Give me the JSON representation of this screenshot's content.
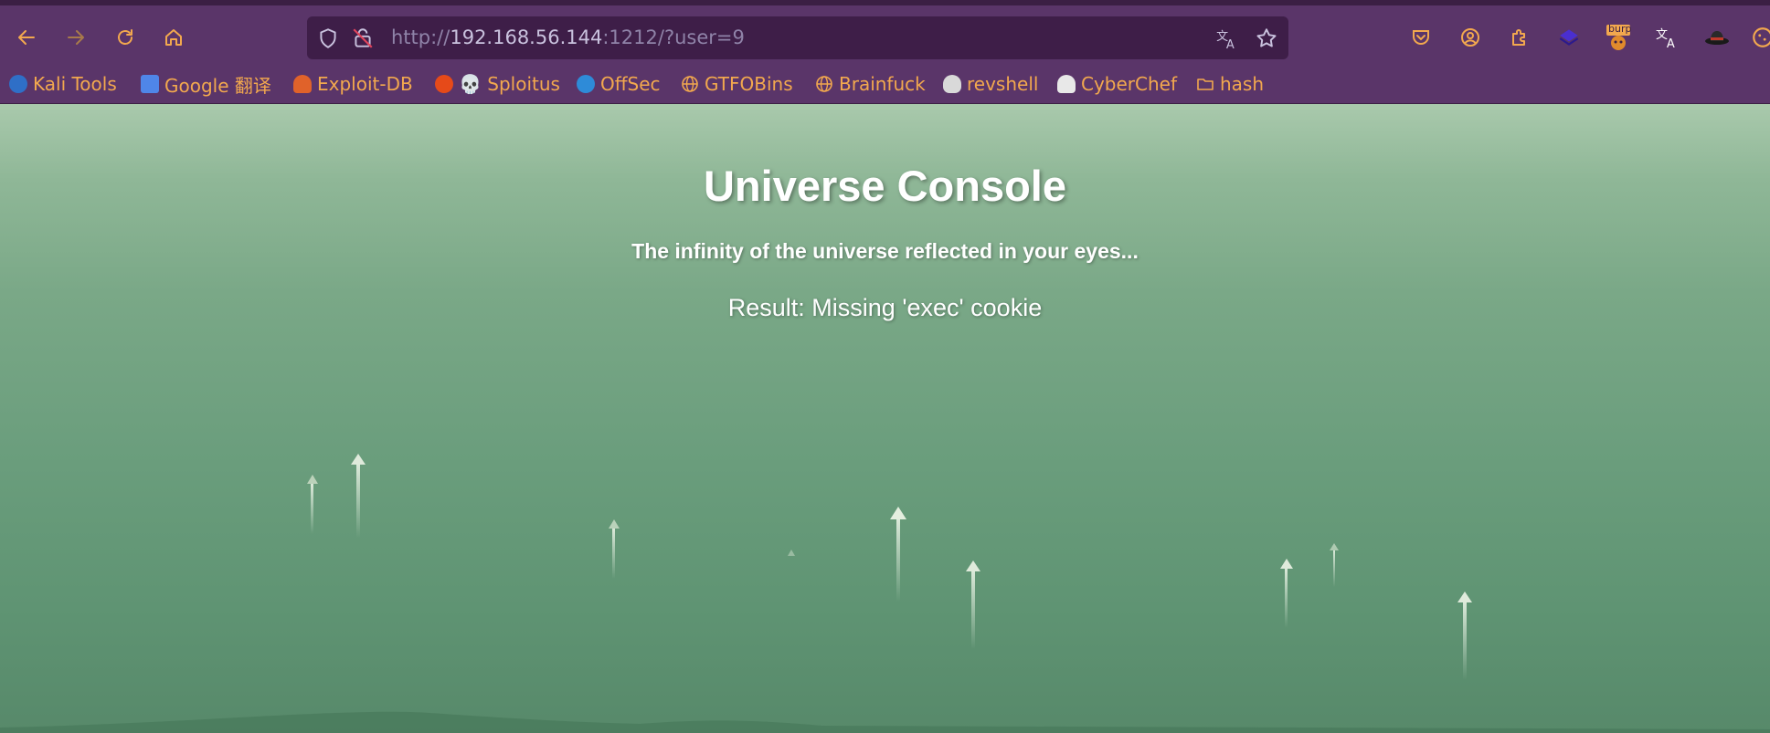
{
  "browser": {
    "url_prefix": "http://",
    "url_host": "192.168.56.144",
    "url_rest": ":1212/?user=9",
    "extension_badge": "burp"
  },
  "bookmarks": [
    {
      "label": "Kali Tools",
      "icon": "kali-icon",
      "color": "#3d7fd6"
    },
    {
      "label": "Google 翻译",
      "icon": "google-translate-icon",
      "color": "#4f86e8"
    },
    {
      "label": "Exploit-DB",
      "icon": "exploit-db-icon",
      "color": "#e0622a"
    },
    {
      "label": "💀 Sploitus",
      "icon": "skull-icon",
      "color": "#e64a19"
    },
    {
      "label": "OffSec",
      "icon": "offsec-icon",
      "color": "#2e8bd8"
    },
    {
      "label": "GTFOBins",
      "icon": "globe-icon",
      "color": "#f2a84e"
    },
    {
      "label": "Brainfuck",
      "icon": "globe-icon",
      "color": "#f2a84e"
    },
    {
      "label": "revshell",
      "icon": "skull-icon",
      "color": "#d9d9d9"
    },
    {
      "label": "CyberChef",
      "icon": "chef-hat-icon",
      "color": "#e8e8e8"
    },
    {
      "label": "hash",
      "icon": "folder-icon",
      "color": "#f2a84e"
    }
  ],
  "page": {
    "title": "Universe Console",
    "subtitle": "The infinity of the universe reflected in your eyes...",
    "result": "Result: Missing 'exec' cookie"
  },
  "colors": {
    "chrome_bg": "#5a3569",
    "urlbar_bg": "#3e1e48",
    "accent": "#f2a84e",
    "page_top": "#a9c9ac",
    "page_bottom": "#57896a"
  }
}
